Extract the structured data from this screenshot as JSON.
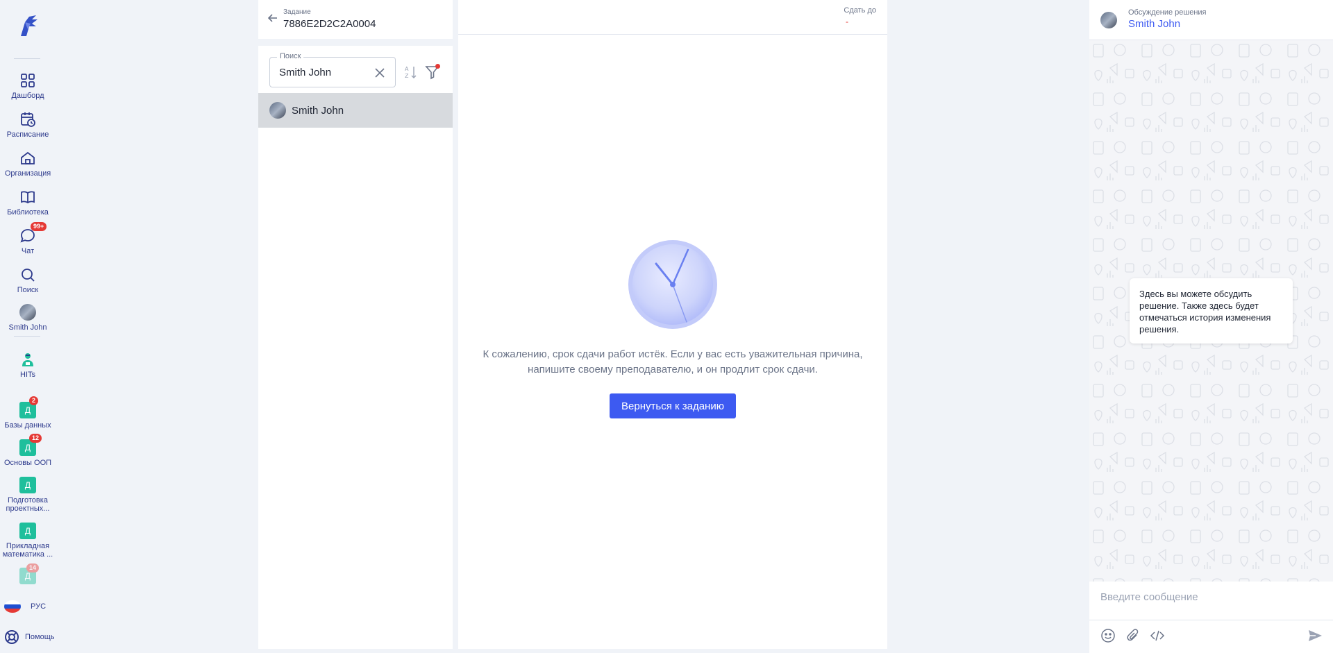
{
  "nav": {
    "items": [
      {
        "label": "Дашборд",
        "icon": "dashboard-icon"
      },
      {
        "label": "Расписание",
        "icon": "schedule-icon"
      },
      {
        "label": "Организация",
        "icon": "organization-icon"
      },
      {
        "label": "Библиотека",
        "icon": "library-icon"
      },
      {
        "label": "Чат",
        "icon": "chat-icon",
        "badge": "99+"
      },
      {
        "label": "Поиск",
        "icon": "search-icon"
      },
      {
        "label": "Smith John",
        "icon": "avatar"
      },
      {
        "label": "HITs",
        "icon": "hits-icon"
      }
    ],
    "courses": [
      {
        "letter": "Д",
        "label": "Базы данных",
        "badge": "2"
      },
      {
        "letter": "Д",
        "label": "Основы ООП",
        "badge": "12"
      },
      {
        "letter": "Д",
        "label": "Подготовка\nпроектных...",
        "badge": ""
      },
      {
        "letter": "Д",
        "label": "Прикладная\nматематика ...",
        "badge": ""
      },
      {
        "letter": "Д",
        "label": "",
        "badge": "14"
      }
    ],
    "language": "РУС",
    "help": "Помощь"
  },
  "task": {
    "label": "Задание",
    "id": "7886E2D2C2A0004"
  },
  "search": {
    "legend": "Поиск",
    "value": "Smith John"
  },
  "students": [
    {
      "name": "Smith John"
    }
  ],
  "main": {
    "due_label": "Сдать до",
    "due_value": "-",
    "message_line1": "К сожалению, срок сдачи работ истёк. Если у вас есть уважительная причина,",
    "message_line2": "напишите своему преподавателю, и он продлит срок сдачи.",
    "return_button": "Вернуться к заданию"
  },
  "chat": {
    "subtitle": "Обсуждение решения",
    "title": "Smith John",
    "bubble": "Здесь вы можете обсудить решение. Также здесь будет отмечаться история изменения решения.",
    "input_placeholder": "Введите сообщение"
  },
  "colors": {
    "accent": "#3d5af1",
    "badge": "#e53935",
    "course": "#1fbf9c",
    "nav_text": "#2d3a8c"
  }
}
